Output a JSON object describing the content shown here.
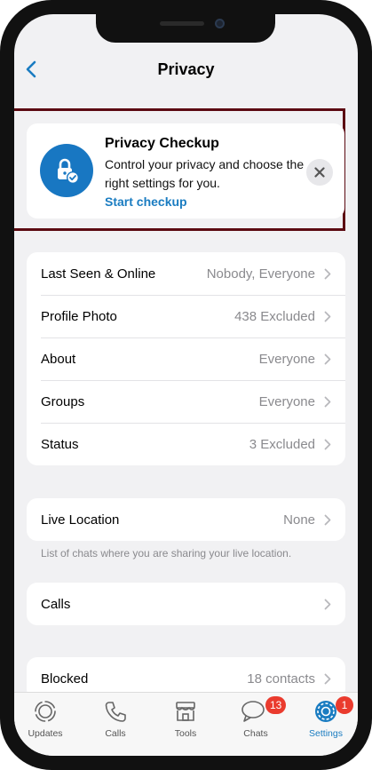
{
  "nav": {
    "title": "Privacy"
  },
  "checkup": {
    "title": "Privacy Checkup",
    "description": "Control your privacy and choose the right settings for you.",
    "link": "Start checkup"
  },
  "privacy_rows": [
    {
      "label": "Last Seen & Online",
      "value": "Nobody, Everyone"
    },
    {
      "label": "Profile Photo",
      "value": "438 Excluded"
    },
    {
      "label": "About",
      "value": "Everyone"
    },
    {
      "label": "Groups",
      "value": "Everyone"
    },
    {
      "label": "Status",
      "value": "3 Excluded"
    }
  ],
  "live_location": {
    "label": "Live Location",
    "value": "None",
    "footnote": "List of chats where you are sharing your live location."
  },
  "calls": {
    "label": "Calls"
  },
  "blocked": {
    "label": "Blocked",
    "value": "18 contacts"
  },
  "tabs": [
    {
      "label": "Updates",
      "icon": "updates-icon"
    },
    {
      "label": "Calls",
      "icon": "phone-icon"
    },
    {
      "label": "Tools",
      "icon": "store-icon"
    },
    {
      "label": "Chats",
      "icon": "chat-bubbles-icon",
      "badge": "13"
    },
    {
      "label": "Settings",
      "icon": "gear-icon",
      "badge": "1",
      "active": true
    }
  ],
  "colors": {
    "accent": "#1a7cc1",
    "badge": "#ea3b2e",
    "highlight_border": "#5c0a12"
  }
}
